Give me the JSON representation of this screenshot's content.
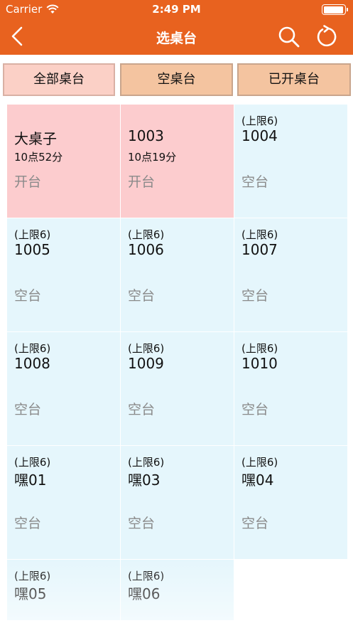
{
  "status_bar": {
    "carrier": "Carrier",
    "time": "2:49 PM",
    "battery_level": 0.95
  },
  "nav": {
    "title": "选桌台",
    "back_icon": "chevron-left-icon",
    "search_icon": "search-icon",
    "refresh_icon": "refresh-icon"
  },
  "tabs": [
    {
      "label": "全部桌台",
      "active": true
    },
    {
      "label": "空桌台",
      "active": false
    },
    {
      "label": "已开桌台",
      "active": false
    }
  ],
  "tables": [
    {
      "name": "大桌子",
      "time": "10点52分",
      "status": "开台",
      "open": true,
      "limit": ""
    },
    {
      "name": "1003",
      "time": "10点19分",
      "status": "开台",
      "open": true,
      "limit": ""
    },
    {
      "name": "1004",
      "time": "",
      "status": "空台",
      "open": false,
      "limit": "(上限6)"
    },
    {
      "name": "1005",
      "time": "",
      "status": "空台",
      "open": false,
      "limit": "(上限6)"
    },
    {
      "name": "1006",
      "time": "",
      "status": "空台",
      "open": false,
      "limit": "(上限6)"
    },
    {
      "name": "1007",
      "time": "",
      "status": "空台",
      "open": false,
      "limit": "(上限6)"
    },
    {
      "name": "1008",
      "time": "",
      "status": "空台",
      "open": false,
      "limit": "(上限6)"
    },
    {
      "name": "1009",
      "time": "",
      "status": "空台",
      "open": false,
      "limit": "(上限6)"
    },
    {
      "name": "1010",
      "time": "",
      "status": "空台",
      "open": false,
      "limit": "(上限6)"
    },
    {
      "name": "嘿01",
      "time": "",
      "status": "空台",
      "open": false,
      "limit": "(上限6)"
    },
    {
      "name": "嘿03",
      "time": "",
      "status": "空台",
      "open": false,
      "limit": "(上限6)"
    },
    {
      "name": "嘿04",
      "time": "",
      "status": "空台",
      "open": false,
      "limit": "(上限6)"
    },
    {
      "name": "嘿05",
      "time": "",
      "status": "",
      "open": false,
      "limit": "(上限6)"
    },
    {
      "name": "嘿06",
      "time": "",
      "status": "",
      "open": false,
      "limit": "(上限6)"
    }
  ],
  "colors": {
    "accent": "#e8621f",
    "tab_bg": "#f4c4a0",
    "tab_active_bg": "#fbd0c6",
    "open_cell_bg": "#fcccce",
    "empty_cell_bg": "#e5f6fc"
  }
}
